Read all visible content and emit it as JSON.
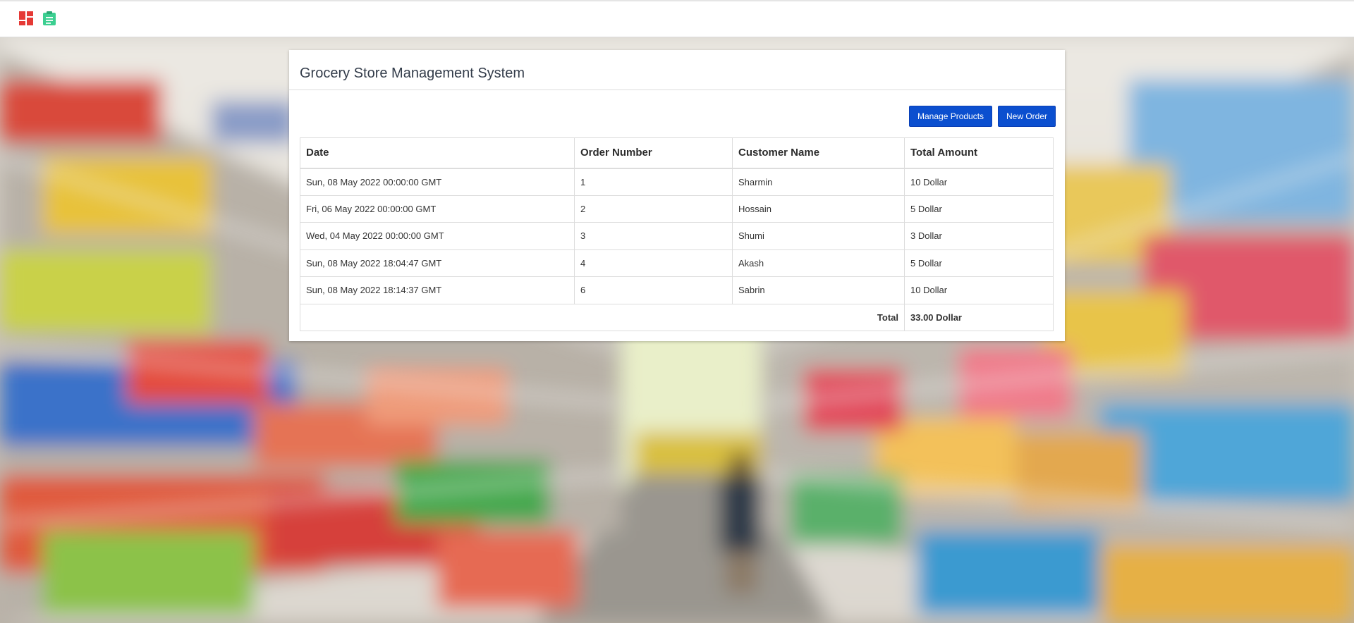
{
  "navbar": {
    "icons": [
      "dashboard-icon",
      "clipboard-icon"
    ],
    "colors": {
      "dashboard": "#e53935",
      "clipboard": "#3ccf91"
    }
  },
  "panel": {
    "title": "Grocery Store Management System",
    "buttons": {
      "manage_products": "Manage Products",
      "new_order": "New Order"
    },
    "button_color": "#0b4fcf"
  },
  "table": {
    "headers": [
      "Date",
      "Order Number",
      "Customer Name",
      "Total Amount"
    ],
    "rows": [
      [
        "Sun, 08 May 2022 00:00:00 GMT",
        "1",
        "Sharmin",
        "10 Dollar"
      ],
      [
        "Fri, 06 May 2022 00:00:00 GMT",
        "2",
        "Hossain",
        "5 Dollar"
      ],
      [
        "Wed, 04 May 2022 00:00:00 GMT",
        "3",
        "Shumi",
        "3 Dollar"
      ],
      [
        "Sun, 08 May 2022 18:04:47 GMT",
        "4",
        "Akash",
        "5 Dollar"
      ],
      [
        "Sun, 08 May 2022 18:14:37 GMT",
        "6",
        "Sabrin",
        "10 Dollar"
      ]
    ],
    "total_label": "Total",
    "total_value": "33.00 Dollar"
  }
}
